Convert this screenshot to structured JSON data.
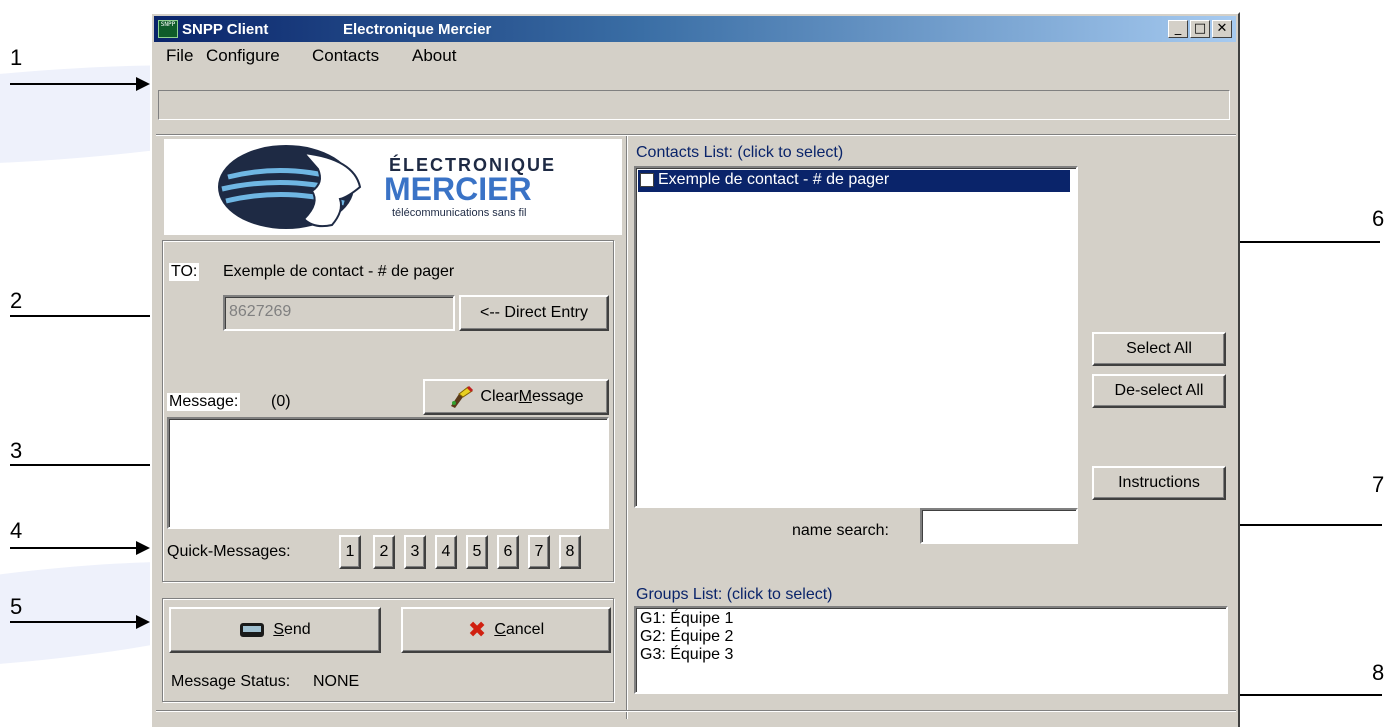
{
  "window": {
    "app_title": "SNPP Client",
    "company_title": "Electronique Mercier",
    "icon_text": "SNPP",
    "min_symbol": "_",
    "max_symbol": "□",
    "close_symbol": "✕"
  },
  "menu": [
    "File",
    "Configure",
    "Contacts",
    "About"
  ],
  "logo": {
    "line1": "ÉLECTRONIQUE",
    "line2": "MERCIER",
    "line3": "télécommunications sans fil"
  },
  "to": {
    "label": "TO:",
    "contact": "Exemple de contact - # de pager",
    "number": "8627269",
    "direct_entry": "<-- Direct Entry"
  },
  "message": {
    "label": "Message:",
    "count": "(0)",
    "clear_prefix": "Clear ",
    "clear_u": "M",
    "clear_rest": "essage",
    "text": ""
  },
  "quick": {
    "label": "Quick-Messages:",
    "buttons": [
      "1",
      "2",
      "3",
      "4",
      "5",
      "6",
      "7",
      "8"
    ]
  },
  "send": {
    "u": "S",
    "rest": "end"
  },
  "cancel": {
    "u": "C",
    "rest": "ancel"
  },
  "status": {
    "label": "Message Status:",
    "value": "NONE"
  },
  "contacts": {
    "label": "Contacts List:  (click to select)",
    "items": [
      {
        "name": "Exemple de contact - # de pager",
        "checked": false,
        "selected": true
      }
    ],
    "select_all": "Select All",
    "deselect_all": "De-select All",
    "instructions": "Instructions",
    "search_label": "name search:",
    "search_value": ""
  },
  "groups": {
    "label": "Groups List:  (click to select)",
    "items": [
      "G1: Équipe 1",
      "G2: Équipe 2",
      "G3: Équipe 3"
    ]
  },
  "annotations": [
    "1",
    "2",
    "3",
    "4",
    "5",
    "6",
    "7",
    "8"
  ],
  "colors": {
    "titlebar_dark": "#0a246a",
    "selection": "#0a246a",
    "face": "#d4d0c8",
    "label_blue": "#0a246a"
  }
}
